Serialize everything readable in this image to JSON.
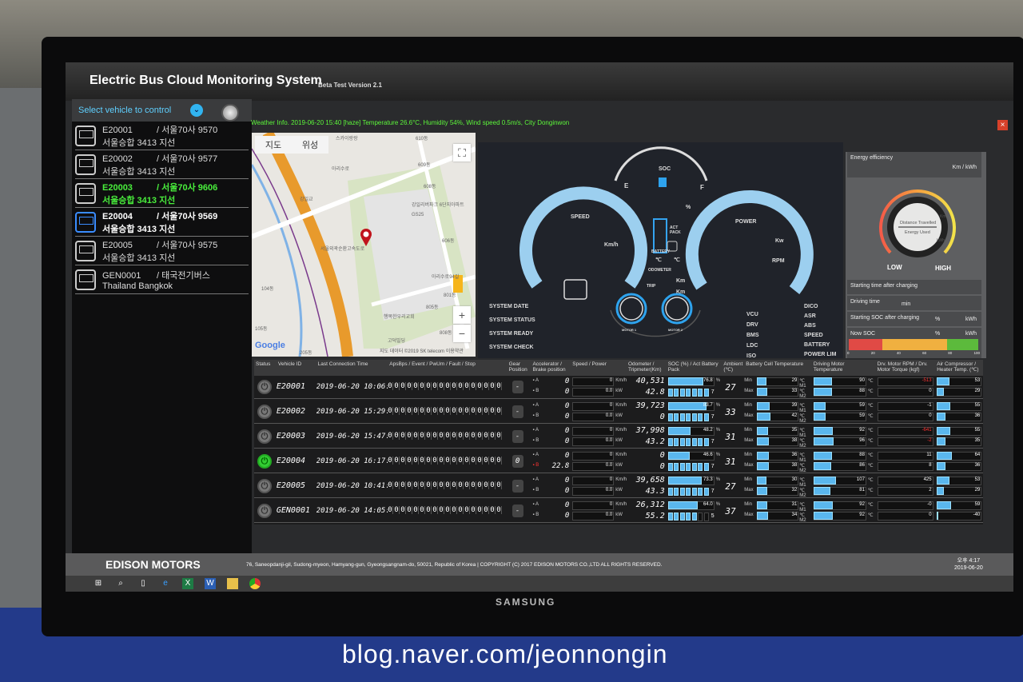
{
  "app": {
    "title": "Electric Bus Cloud Monitoring System",
    "version": "Beta Test Version 2.1",
    "select_label": "Select vehicle to control",
    "weather": "Weather Info. 2019-06-20 15:40 [haze] Temperature 26.6°C, Humidity 54%, Wind speed 0.5m/s, City Donginwon",
    "close": "×"
  },
  "vehicles": [
    {
      "id": "E20001",
      "plate": "/ 서울70사 9570",
      "line": "서울승합 3413 지선",
      "state": "normal"
    },
    {
      "id": "E20002",
      "plate": "/ 서울70사 9577",
      "line": "서울승합 3413 지선",
      "state": "normal"
    },
    {
      "id": "E20003",
      "plate": "/ 서울70사 9606",
      "line": "서울승합 3413 지선",
      "state": "green"
    },
    {
      "id": "E20004",
      "plate": "/ 서울70사 9569",
      "line": "서울승합 3413 지선",
      "state": "selected"
    },
    {
      "id": "E20005",
      "plate": "/ 서울70사 9575",
      "line": "서울승합 3413 지선",
      "state": "normal"
    },
    {
      "id": "GEN0001",
      "plate": "/ 태국전기버스",
      "line": "Thailand Bangkok",
      "state": "normal"
    }
  ],
  "map": {
    "tab_map": "지도",
    "tab_satellite": "위성",
    "fullscreen": "⛶",
    "zoom_in": "+",
    "zoom_out": "−",
    "google": "Google",
    "copyright": "지도 데이터 ©2019 SK telecom  이용약관",
    "labels": [
      "스카이랑랑",
      "아리수로",
      "강일교",
      "서울외곽순환고속도로",
      "강일리버파크 6단지아파트",
      "GS25",
      "609동",
      "608동",
      "606동",
      "아리수로94길",
      "801동",
      "805동",
      "808동",
      "행복한우리교회",
      "고덕빌딩",
      "104동",
      "105동",
      "205동",
      "610동"
    ]
  },
  "dashboard": {
    "soc": "SOC",
    "e": "E",
    "f": "F",
    "pct": "%",
    "speed": "SPEED",
    "kmh": "Km/h",
    "power": "POWER",
    "kw": "Kw",
    "rpm": "RPM",
    "battery": "BATTERY",
    "act_pack": "ACT PACK",
    "deg1": "℃",
    "deg2": "℃",
    "odometer": "ODOMETER",
    "trip": "TRIP",
    "km1": "Km",
    "km2": "Km",
    "motor1": "MOTOR 1",
    "motor2": "MOTOR 2",
    "system": [
      "SYSTEM DATE",
      "SYSTEM STATUS",
      "SYSTEM READY",
      "SYSTEM CHECK"
    ],
    "units": [
      "VCU",
      "DRV",
      "BMS",
      "LDC",
      "ISO"
    ],
    "status": [
      "DICO",
      "ASR",
      "ABS",
      "SPEED",
      "BATTERY",
      "POWER LIM"
    ]
  },
  "energy": {
    "title": "Energy efficiency",
    "unit": "Km / kWh",
    "km": "Km",
    "distance": "Distance Travelled",
    "energy_used": "Energy Used",
    "kwh": "kWh",
    "low": "LOW",
    "high": "HIGH",
    "start_time": "Starting time after charging",
    "driving_time": "Driving time",
    "min": "min",
    "start_soc": "Starting SOC after charging",
    "pct": "%",
    "kwh2": "kWh",
    "now_soc": "Now SOC",
    "pct2": "%",
    "kwh3": "kWh",
    "ticks": [
      "0",
      "20",
      "40",
      "60",
      "80",
      "100"
    ],
    "colors": {
      "low": "#e04a45",
      "mid": "#f0b040",
      "high": "#5cba3c"
    }
  },
  "table": {
    "headers": [
      "Status",
      "Vehicle ID",
      "Last Connection Time",
      "ApsBps / Event / PwUm / Fault / Stop",
      "Gear Position",
      "Accelerator / Brake position",
      "Speed / Power",
      "Odometer / Tripmeter(Km)",
      "SOC (%) / Act Battery Pack",
      "Ambient (℃)",
      "Battery Cell Temperature",
      "Driving Motor Temperature",
      "Drv. Motor RPM / Drv. Motor Torque (kgf)",
      "Air Compressor / Heater Temp. (℃)"
    ],
    "sub": {
      "a": "A",
      "b": "B",
      "kmh": "Km/h",
      "kw": "kW",
      "pct": "%",
      "min": "Min",
      "max": "Max",
      "m1": "℃ M1",
      "m2": "℃ M2",
      "deg": "℃"
    },
    "rows": [
      {
        "on": false,
        "id": "E20001",
        "time": "2019-06-20 10:06:04",
        "gear": "-",
        "acc": "0",
        "brake": "0",
        "speed": "0",
        "power": "0.0",
        "odo": "40,531",
        "trip": "42.8",
        "soc": 76.8,
        "pack": "7",
        "amb": "27",
        "cmin": "29",
        "cmax": "33",
        "m1": "90",
        "m2": "88",
        "rpm": "-513",
        "torque": "0",
        "rpm_red": true,
        "torque_red": false,
        "air": "53",
        "heater": "29"
      },
      {
        "on": false,
        "id": "E20002",
        "time": "2019-06-20 15:29:56",
        "gear": "-",
        "acc": "0",
        "brake": "0",
        "speed": "0",
        "power": "0.0",
        "odo": "39,723",
        "trip": "0",
        "soc": 83.7,
        "pack": "7",
        "amb": "33",
        "cmin": "39",
        "cmax": "42",
        "m1": "59",
        "m2": "59",
        "rpm": "-1",
        "torque": "0",
        "rpm_red": false,
        "torque_red": false,
        "air": "55",
        "heater": "36"
      },
      {
        "on": false,
        "id": "E20003",
        "time": "2019-06-20 15:47:43",
        "gear": "-",
        "acc": "0",
        "brake": "0",
        "speed": "0",
        "power": "0.0",
        "odo": "37,998",
        "trip": "43.2",
        "soc": 48.2,
        "pack": "7",
        "amb": "31",
        "cmin": "35",
        "cmax": "38",
        "m1": "92",
        "m2": "96",
        "rpm": "-641",
        "torque": "-2",
        "rpm_red": true,
        "torque_red": true,
        "air": "55",
        "heater": "35"
      },
      {
        "on": true,
        "id": "E20004",
        "time": "2019-06-20 16:17:24",
        "gear": "0",
        "acc": "0",
        "brake": "22.8",
        "speed": "0",
        "power": "0.0",
        "odo": "0",
        "trip": "0",
        "soc": 46.6,
        "pack": "7",
        "amb": "31",
        "cmin": "36",
        "cmax": "38",
        "m1": "88",
        "m2": "86",
        "rpm": "11",
        "torque": "8",
        "rpm_red": false,
        "torque_red": false,
        "air": "64",
        "heater": "36"
      },
      {
        "on": false,
        "id": "E20005",
        "time": "2019-06-20 10:41:52",
        "gear": "-",
        "acc": "0",
        "brake": "0",
        "speed": "0",
        "power": "0.0",
        "odo": "39,658",
        "trip": "43.3",
        "soc": 73.3,
        "pack": "7",
        "amb": "27",
        "cmin": "30",
        "cmax": "32",
        "m1": "107",
        "m2": "81",
        "rpm": "425",
        "torque": "2",
        "rpm_red": false,
        "torque_red": false,
        "air": "53",
        "heater": "29"
      },
      {
        "on": false,
        "id": "GEN0001",
        "time": "2019-06-20 14:05:17",
        "gear": "-",
        "acc": "0",
        "brake": "0",
        "speed": "0",
        "power": "0.0",
        "odo": "26,312",
        "trip": "55.2",
        "soc": 64.0,
        "pack": "5",
        "amb": "37",
        "cmin": "31",
        "cmax": "34",
        "m1": "92",
        "m2": "92",
        "rpm": "-0",
        "torque": "0",
        "rpm_red": false,
        "torque_red": false,
        "air": "59",
        "heater": "-40"
      }
    ],
    "bits": "000000000000000000"
  },
  "footer": {
    "brand": "EDISON MOTORS",
    "address": "76, Saneopdanji-gil, Sudong-myeon, Hamyang-gun, Gyeongsangnam-do, 50021, Republic of Korea  |  COPYRIGHT (C) 2017 EDISON MOTORS CO.,LTD ALL RIGHTS RESERVED.",
    "time": "오후 4:17",
    "date": "2019-06-20"
  },
  "monitor": {
    "brand": "SAMSUNG"
  },
  "photo": {
    "watermark": "blog.naver.com/jeonnongin"
  }
}
